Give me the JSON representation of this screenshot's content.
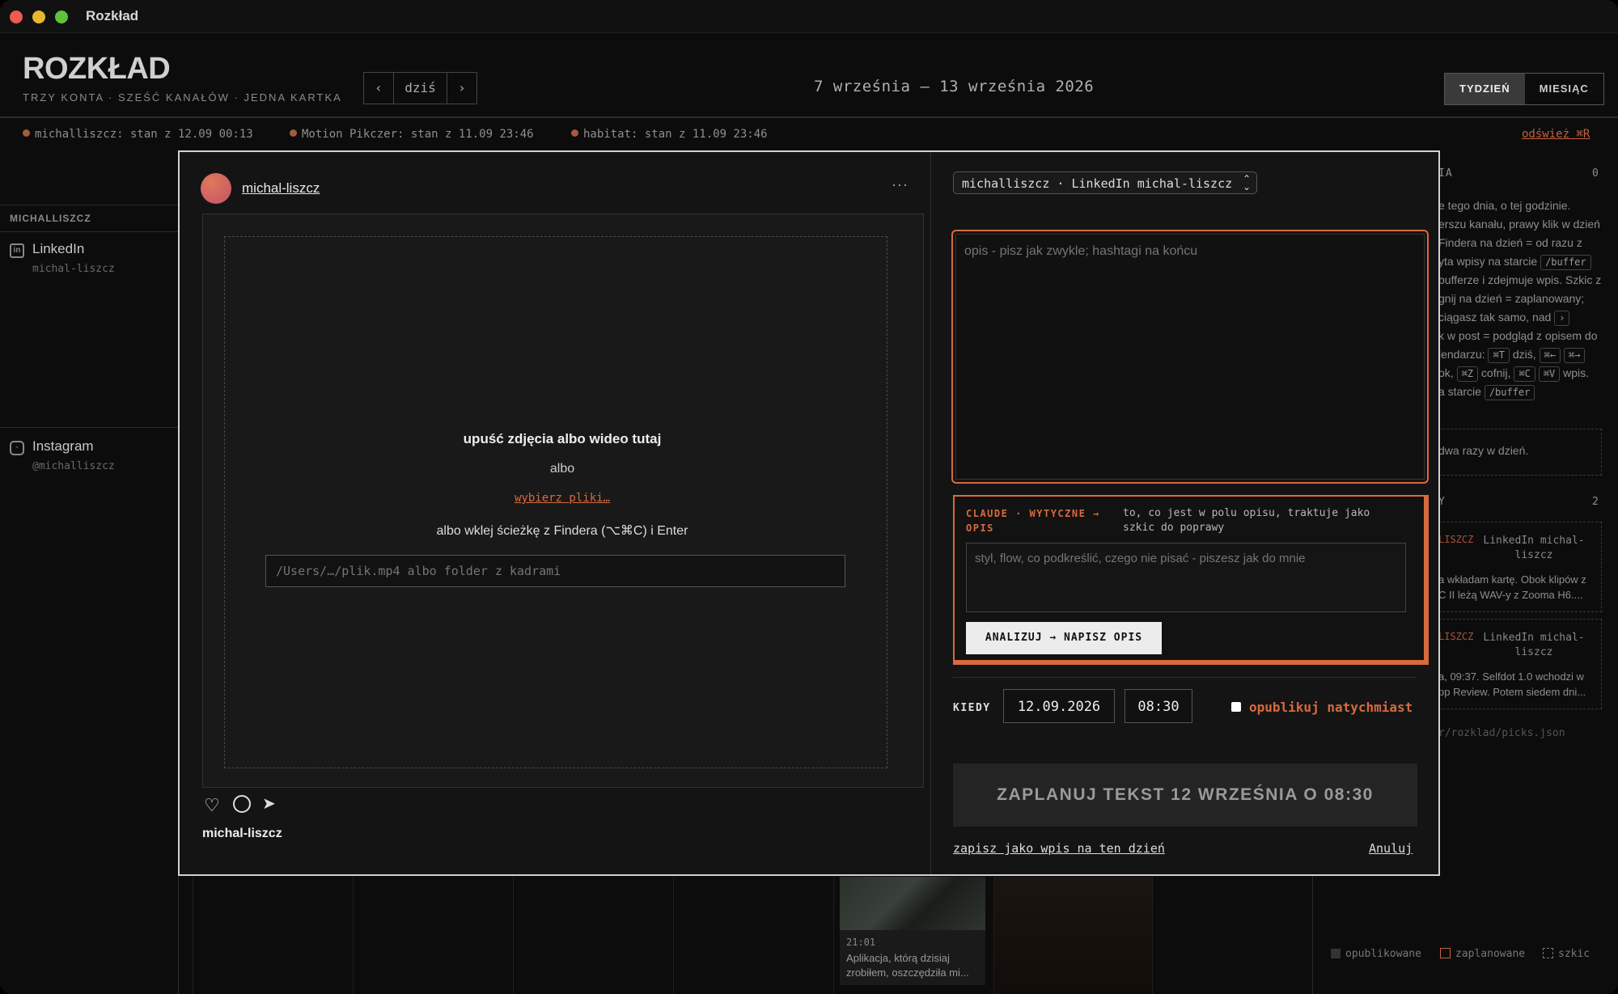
{
  "window": {
    "title": "Rozkład"
  },
  "header": {
    "logo": "ROZKŁAD",
    "tagline": "TRZY KONTA · SZEŚĆ KANAŁÓW · JEDNA KARTKA",
    "nav": {
      "prev": "‹",
      "today": "dziś",
      "next": "›"
    },
    "date_range": "7 września – 13 września 2026",
    "views": [
      "TYDZIEŃ",
      "MIESIĄC"
    ],
    "active_view": "TYDZIEŃ"
  },
  "status_bar": {
    "items": [
      "michalliszcz: stan z 12.09 00:13",
      "Motion Pikczer: stan z 11.09 23:46",
      "habitat: stan z 11.09 23:46"
    ],
    "refresh": "odśwież ⌘R"
  },
  "sidebar": {
    "account_header": "MICHALLISZCZ",
    "channels": [
      {
        "name": "LinkedIn",
        "handle": "michal-liszcz",
        "icon": "linkedin-icon"
      },
      {
        "name": "Instagram",
        "handle": "@michalliszcz",
        "icon": "instagram-icon"
      }
    ]
  },
  "right_panel": {
    "section1_label": "IA",
    "section1_count": "0",
    "help_lines": [
      "e tego dnia, o tej godzinie.",
      "erszu kanału, prawy klik w dzień",
      "Findera na dzień = od razu z",
      "yta wpisy na starcie",
      "bufferze i zdejmuje wpis. Szkic z",
      "gnij na dzień = zaplanowany;",
      "ciągasz tak samo, nad",
      "k w post = podgląd z opisem do",
      "lendarzu:",
      "ok,",
      "a starcie"
    ],
    "kbd": {
      "buffer": "/buffer",
      "arrow": "›",
      "cmd_t": "⌘T",
      "today_word": "dziś,",
      "cmd_left": "⌘←",
      "cmd_right": "⌘→",
      "cmd_z": "⌘Z",
      "undo_word": "cofnij,",
      "cmd_c": "⌘C",
      "cmd_v": "⌘V",
      "paste_word": "wpis."
    },
    "note": "dwa razy w dzień.",
    "section2_label": "Y",
    "section2_count": "2",
    "cards": [
      {
        "account": "LISZCZ",
        "channel": "LinkedIn michal-liszcz",
        "text": "a wkładam kartę. Obok klipów z C II leżą WAV-y z Zooma H6...."
      },
      {
        "account": "LISZCZ",
        "channel": "LinkedIn michal-liszcz",
        "text": "a, 09:37. Selfdot 1.0 wchodzi w pp Review. Potem siedem dni..."
      }
    ],
    "path": "r/rozklad/picks.json",
    "legend": [
      "opublikowane",
      "zaplanowane",
      "szkic"
    ]
  },
  "bottom_post": {
    "time": "21:01",
    "text": "Aplikacja, którą dzisiaj zrobiłem, oszczędziła mi..."
  },
  "modal": {
    "preview": {
      "username": "michal-liszcz",
      "more": "···",
      "drop_title": "upuść zdjęcia albo wideo tutaj",
      "or": "albo",
      "choose_files": "wybierz pliki…",
      "paste_hint": "albo wklej ścieżkę z Findera (⌥⌘C) i Enter",
      "path_placeholder": "/Users/…/plik.mp4 albo folder z kadrami",
      "footer_username": "michal-liszcz"
    },
    "editor": {
      "channel_select": "michalliszcz · LinkedIn michal-liszcz",
      "description_placeholder": "opis - pisz jak zwykle; hashtagi na końcu",
      "claude_label": "CLAUDE · WYTYCZNE → OPIS",
      "claude_desc": "to, co jest w polu opisu, traktuje jako szkic do poprawy",
      "guidelines_placeholder": "styl, flow, co podkreślić, czego nie pisać - piszesz jak do mnie",
      "analyze_button": "ANALIZUJ → NAPISZ OPIS",
      "when_label": "KIEDY",
      "date": "12.09.2026",
      "time": "08:30",
      "publish_now": "opublikuj natychmiast",
      "schedule_button": "ZAPLANUJ TEKST 12 WRZEŚNIA O 08:30",
      "save_draft": "zapisz jako wpis na ten dzień",
      "cancel": "Anuluj"
    }
  },
  "colors": {
    "accent": "#d86a3e",
    "background": "#0c0c0c",
    "modal": "#141414"
  }
}
